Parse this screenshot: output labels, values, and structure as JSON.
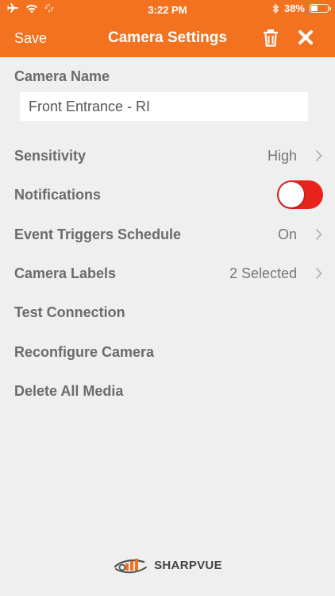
{
  "status_bar": {
    "time": "3:22 PM",
    "battery": "38%",
    "battery_level": 0.38
  },
  "nav": {
    "save_label": "Save",
    "title": "Camera Settings",
    "delete_icon": "trash-icon",
    "close_icon": "close-icon"
  },
  "camera_name": {
    "label": "Camera Name",
    "value": "Front Entrance - RI"
  },
  "settings": {
    "sensitivity": {
      "label": "Sensitivity",
      "value": "High"
    },
    "notifications": {
      "label": "Notifications",
      "enabled": true
    },
    "event_triggers": {
      "label": "Event Triggers Schedule",
      "value": "On"
    },
    "camera_labels": {
      "label": "Camera Labels",
      "value": "2 Selected"
    },
    "test_connection": {
      "label": "Test Connection"
    },
    "reconfigure": {
      "label": "Reconfigure Camera"
    },
    "delete_media": {
      "label": "Delete All Media"
    }
  },
  "brand": {
    "name": "SHARPVUE"
  },
  "colors": {
    "accent": "#f3721f",
    "toggle_on": "#e8231b",
    "background": "#efefef"
  }
}
